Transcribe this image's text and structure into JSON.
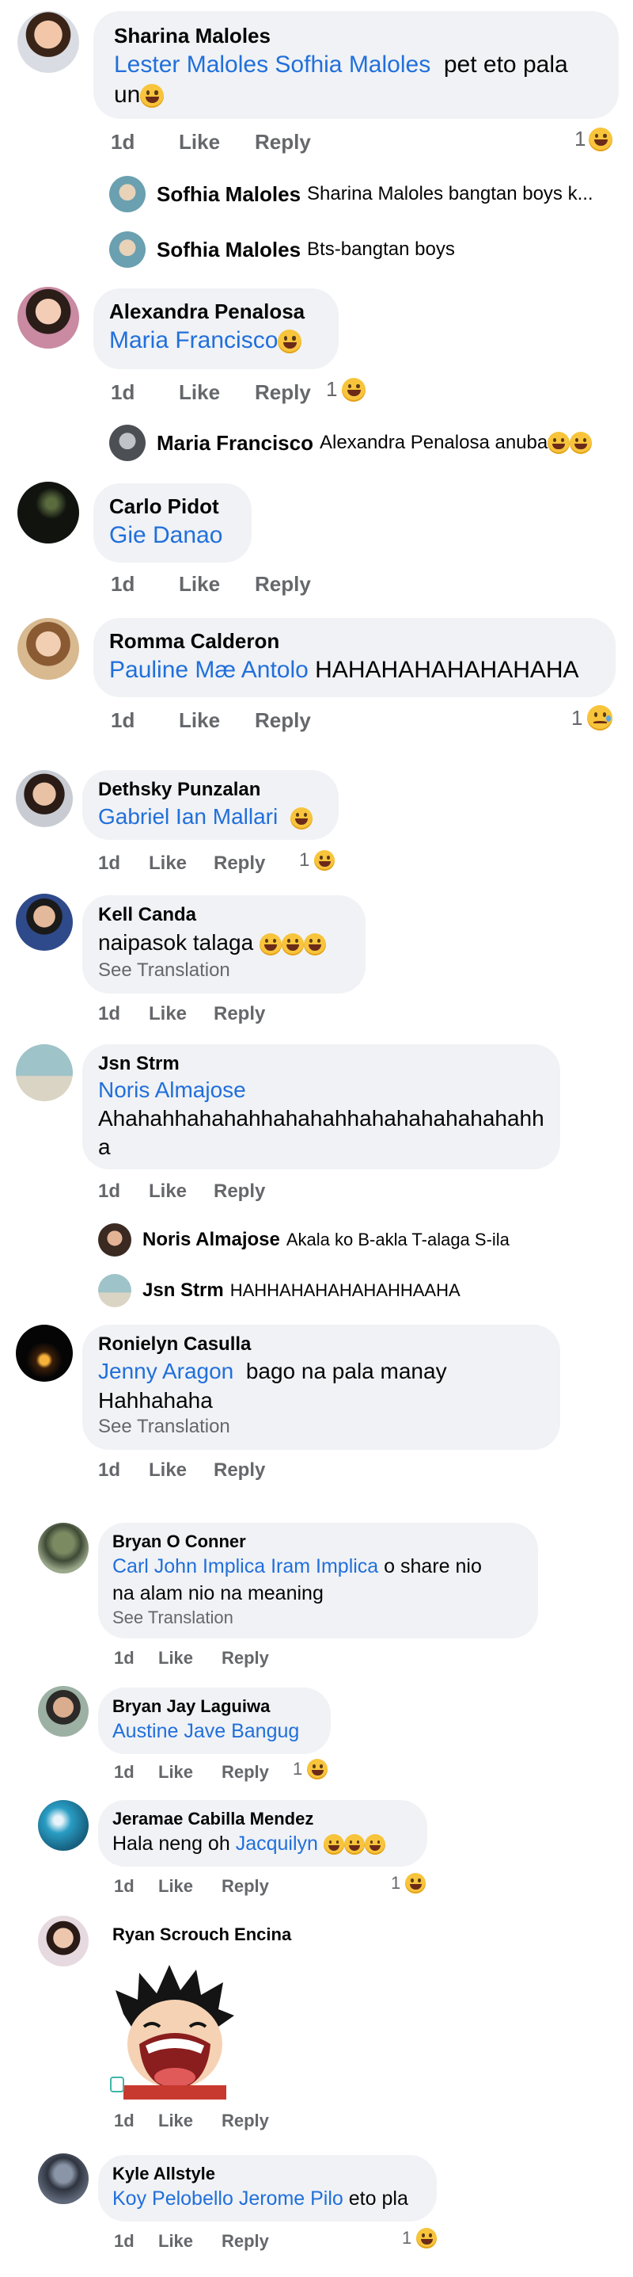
{
  "actions": {
    "time": "1d",
    "like": "Like",
    "reply": "Reply"
  },
  "comments": [
    {
      "author": "Sharina Maloles",
      "mentions": "Lester Maloles Sofhia Maloles",
      "text": "pet eto pala",
      "text2": "un",
      "reaction_count": "1",
      "replies": [
        {
          "author": "Sofhia Maloles",
          "text": "Sharina Maloles bangtan boys k..."
        },
        {
          "author": "Sofhia Maloles",
          "text": "Bts-bangtan boys"
        }
      ]
    },
    {
      "author": "Alexandra Penalosa",
      "mentions": "Maria Francisco",
      "reaction_count": "1",
      "replies": [
        {
          "author": "Maria Francisco",
          "text": "Alexandra Penalosa anuba"
        }
      ]
    },
    {
      "author": "Carlo Pidot",
      "mentions": "Gie Danao"
    },
    {
      "author": "Romma Calderon",
      "mentions": "Pauline Mæ Antolo",
      "text": "HAHAHAHAHAHAHAHA",
      "reaction_count": "1"
    },
    {
      "author": "Dethsky Punzalan",
      "mentions": "Gabriel Ian Mallari",
      "reaction_count": "1"
    },
    {
      "author": "Kell Canda",
      "text": "naipasok talaga",
      "see_translation": "See Translation"
    },
    {
      "author": "Jsn Strm",
      "mentions": "Noris Almajose",
      "text": "Ahahahhahahahhahahahhahahahahahahahh",
      "text2": "a",
      "replies": [
        {
          "author": "Noris Almajose",
          "text": "Akala ko B-akla T-alaga S-ila"
        },
        {
          "author": "Jsn Strm",
          "text": "HAHHAHAHAHAHAHHAAHA"
        }
      ]
    },
    {
      "author": "Ronielyn Casulla",
      "mentions": "Jenny Aragon",
      "text": "bago na pala manay",
      "text2": "Hahhahaha",
      "see_translation": "See Translation"
    },
    {
      "author": "Bryan O Conner",
      "mentions": "Carl John Implica Iram Implica",
      "text": "o share nio",
      "text2": "na alam nio na meaning",
      "see_translation": "See Translation"
    },
    {
      "author": "Bryan Jay Laguiwa",
      "mentions": "Austine Jave Bangug",
      "reaction_count": "1"
    },
    {
      "author": "Jeramae Cabilla Mendez",
      "text": "Hala neng oh",
      "mentions": "Jacquilyn",
      "reaction_count": "1"
    },
    {
      "author": "Ryan Scrouch Encina"
    },
    {
      "author": "Kyle Allstyle",
      "mentions": "Koy Pelobello Jerome Pilo",
      "text": "eto pla",
      "reaction_count": "1"
    }
  ],
  "icons": {
    "laugh": "laughing-emoji-icon",
    "sad": "crying-emoji-icon"
  },
  "colors": {
    "mention": "#216fdb",
    "bubble": "#f0f2f5",
    "meta": "#65676b"
  }
}
